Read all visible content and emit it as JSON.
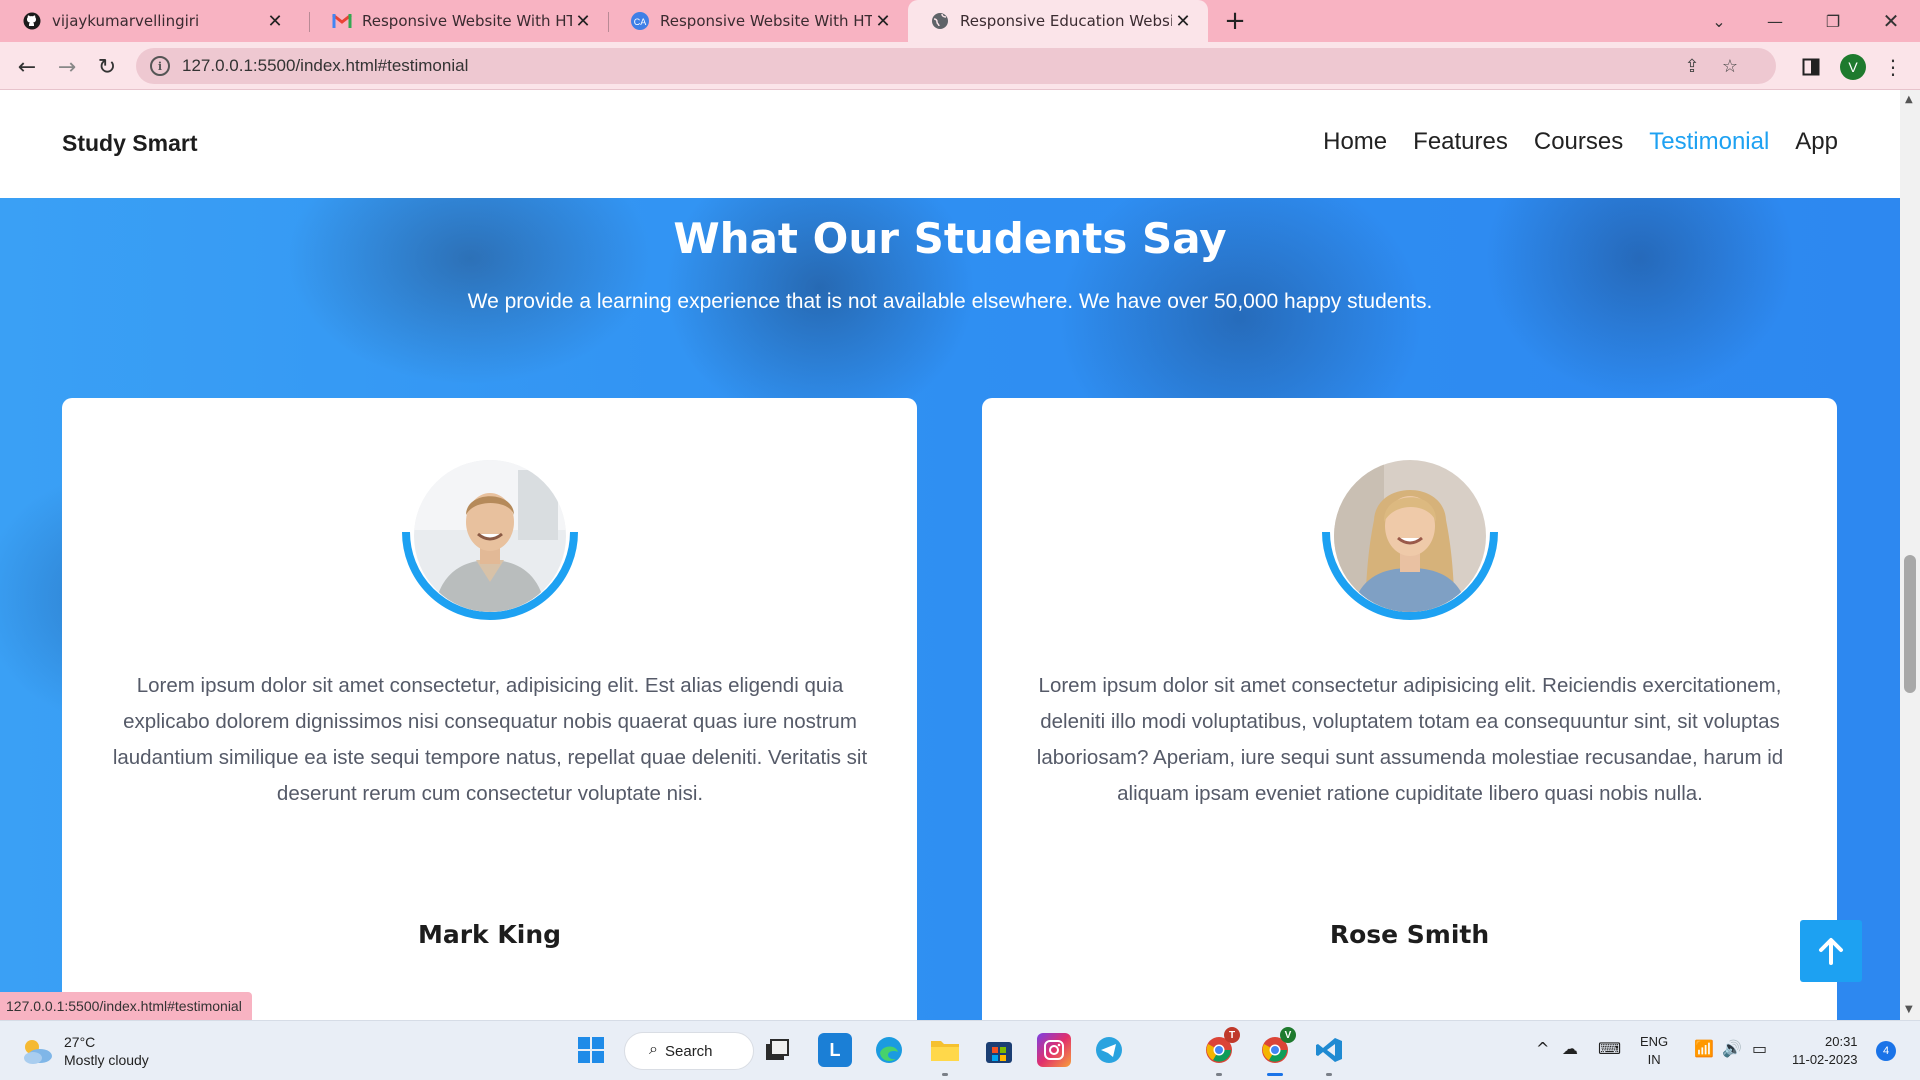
{
  "browser": {
    "tabs": [
      {
        "label": "vijaykumarvellingiri",
        "icon": "github-icon"
      },
      {
        "label": "Responsive Website With HTML",
        "icon": "gmail-icon"
      },
      {
        "label": "Responsive Website With HTML",
        "icon": "site-icon"
      },
      {
        "label": "Responsive Education Website",
        "icon": "globe-icon",
        "active": true
      }
    ],
    "url": "127.0.0.1:5500/index.html#testimonial",
    "profile_initial": "V",
    "status_url": "127.0.0.1:5500/index.html#testimonial"
  },
  "site": {
    "brand": "Study Smart",
    "nav": [
      "Home",
      "Features",
      "Courses",
      "Testimonial",
      "App"
    ],
    "active_nav": "Testimonial",
    "accent_color": "#1da1f2"
  },
  "testimonials": {
    "title": "What Our Students Say",
    "subtitle": "We provide a learning experience that is not available elsewhere. We have over 50,000 happy students.",
    "cards": [
      {
        "quote": "Lorem ipsum dolor sit amet consectetur, adipisicing elit. Est alias eligendi quia explicabo dolorem dignissimos nisi consequatur nobis quaerat quas iure nostrum laudantium similique ea iste sequi tempore natus, repellat quae deleniti. Veritatis sit deserunt rerum cum consectetur voluptate nisi.",
        "name": "Mark King"
      },
      {
        "quote": "Lorem ipsum dolor sit amet consectetur adipisicing elit. Reiciendis exercitationem, deleniti illo modi voluptatibus, voluptatem totam ea consequuntur sint, sit voluptas laboriosam? Aperiam, iure sequi sunt assumenda molestiae recusandae, harum id aliquam ipsam eveniet ratione cupiditate libero quasi nobis nulla.",
        "name": "Rose Smith"
      }
    ]
  },
  "taskbar": {
    "weather_temp": "27°C",
    "weather_desc": "Mostly cloudy",
    "search_label": "Search",
    "lang_top": "ENG",
    "lang_bottom": "IN",
    "time": "20:31",
    "date": "11-02-2023",
    "notification_count": "4",
    "chrome_badge_1": "T",
    "chrome_badge_2": "V"
  }
}
